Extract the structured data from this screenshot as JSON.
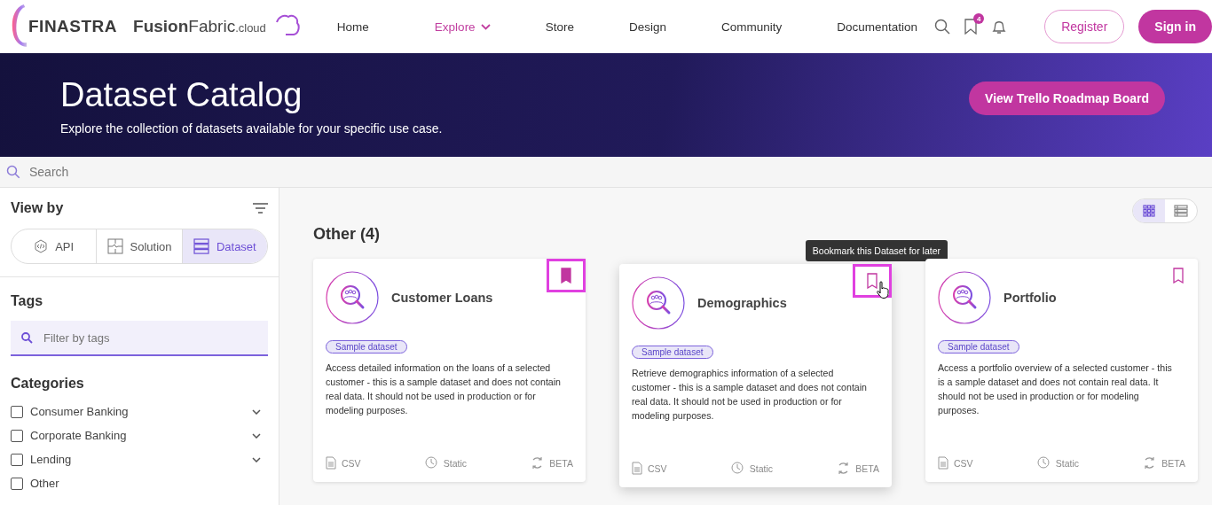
{
  "header": {
    "logo": "FINASTRA",
    "brand": "**Fusion**Fabric",
    "brand_suffix": ".cloud",
    "nav": [
      {
        "label": "Home",
        "selected": false,
        "dropdown": false
      },
      {
        "label": "Explore",
        "selected": true,
        "dropdown": true
      },
      {
        "label": "Store",
        "selected": false,
        "dropdown": false
      },
      {
        "label": "Design",
        "selected": false,
        "dropdown": false
      },
      {
        "label": "Community",
        "selected": false,
        "dropdown": false
      },
      {
        "label": "Documentation",
        "selected": false,
        "dropdown": false
      }
    ],
    "bookmark_count": "4",
    "register": "Register",
    "sign_in": "Sign in"
  },
  "hero": {
    "title": "Dataset Catalog",
    "subtitle": "Explore the collection of datasets available for your specific use case.",
    "button": "View Trello Roadmap Board"
  },
  "search": {
    "placeholder": "Search"
  },
  "sidebar": {
    "view_by": "View by",
    "views": [
      {
        "label": "API",
        "kind": "api",
        "selected": false
      },
      {
        "label": "Solution",
        "kind": "solution",
        "selected": false
      },
      {
        "label": "Dataset",
        "kind": "dataset",
        "selected": true
      }
    ],
    "tags_title": "Tags",
    "tags_placeholder": "Filter by tags",
    "categories_title": "Categories",
    "categories": [
      {
        "label": "Consumer Banking",
        "checked": false,
        "expandable": true
      },
      {
        "label": "Corporate Banking",
        "checked": false,
        "expandable": true
      },
      {
        "label": "Lending",
        "checked": false,
        "expandable": true
      },
      {
        "label": "Other",
        "checked": false,
        "expandable": false
      }
    ]
  },
  "main": {
    "layouts": [
      {
        "kind": "grid",
        "selected": true
      },
      {
        "kind": "list",
        "selected": false
      }
    ],
    "heading": "Other (4)",
    "cards": [
      {
        "title": "Customer Loans",
        "tag": "Sample dataset",
        "description": "Access detailed information on the loans of a selected customer - this is a sample dataset and does not contain real data. It should not be used in production or for modeling purposes.",
        "format": "CSV",
        "frequency": "Static",
        "status": "BETA",
        "bookmarked": true,
        "highlighted": true,
        "hovered": false
      },
      {
        "title": "Demographics",
        "tag": "Sample dataset",
        "description": "Retrieve demographics information of a selected customer - this is a sample dataset and does not contain real data. It should not be used in production or for modeling purposes.",
        "format": "CSV",
        "frequency": "Static",
        "status": "BETA",
        "bookmarked": false,
        "highlighted": true,
        "hovered": true,
        "tooltip": "Bookmark this Dataset for later"
      },
      {
        "title": "Portfolio",
        "tag": "Sample dataset",
        "description": "Access a portfolio overview of a selected customer - this is a sample dataset and does not contain real data. It should not be used in production or for modeling purposes.",
        "format": "CSV",
        "frequency": "Static",
        "status": "BETA",
        "bookmarked": false,
        "highlighted": false,
        "hovered": false
      }
    ]
  }
}
